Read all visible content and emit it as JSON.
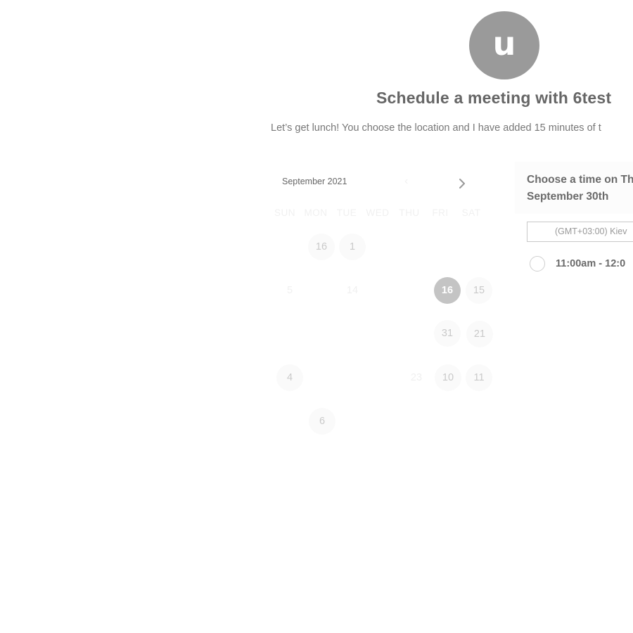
{
  "avatar": {
    "initial": "u"
  },
  "header": {
    "title": "Schedule a meeting with 6test",
    "description": "Let’s get lunch! You choose the location and I have added 15 minutes of t"
  },
  "calendar": {
    "month_label": "September 2021",
    "prev_arrow": "‹",
    "next_icon": "chevron-right-icon",
    "weekdays": [
      "SUN",
      "MON",
      "TUE",
      "WED",
      "THU",
      "FRI",
      "SAT"
    ],
    "days": {
      "r1_mon": "16",
      "r1_tue": "1",
      "r2_sun": "5",
      "r2_tue": "14",
      "r2_fri": "16",
      "r2_sat": "15",
      "r3_fri": "31",
      "r3_sat": "21",
      "r4_sun": "4",
      "r4_thu": "23",
      "r4_fri": "10",
      "r4_sat": "11",
      "r5_mon": "6"
    },
    "selected_day": "16"
  },
  "time_picker": {
    "heading": "Choose a time on Th September 30th",
    "timezone": "(GMT+03:00) Kiev",
    "slots": [
      "11:00am - 12:0"
    ]
  },
  "colors": {
    "avatar_bg": "#9a9a9a",
    "selected_day_bg": "#c4c4c4",
    "text_dark": "#666666"
  }
}
